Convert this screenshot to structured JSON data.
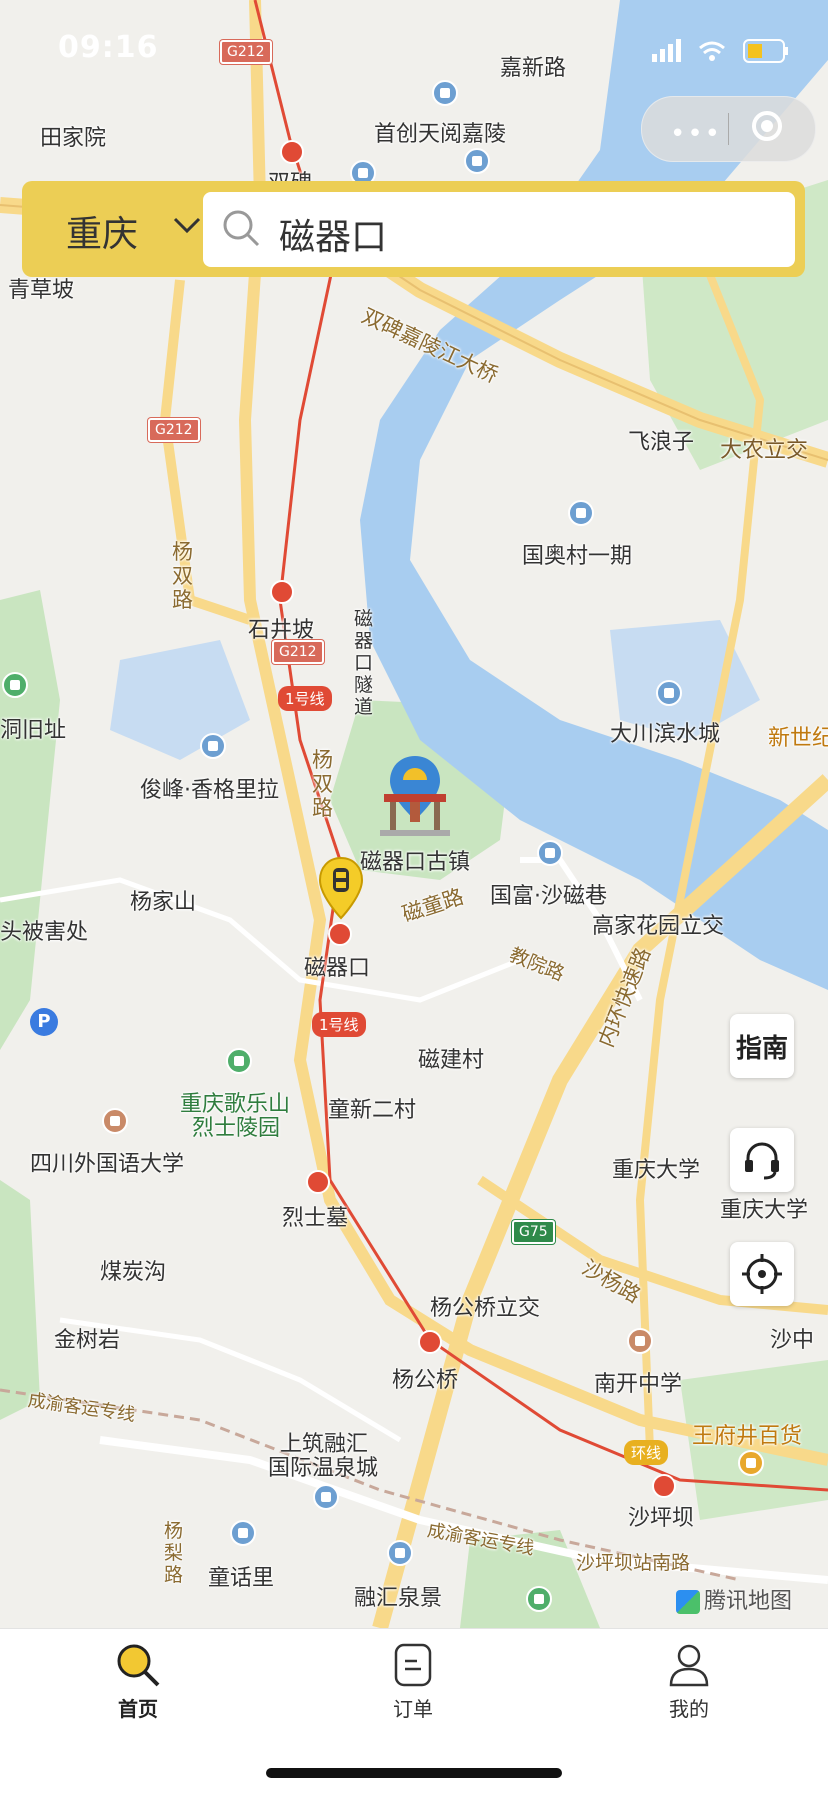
{
  "status_bar": {
    "time": "09:16"
  },
  "header": {
    "city": "重庆",
    "search_value": "磁器口"
  },
  "side_buttons": {
    "guide_label": "指南"
  },
  "map": {
    "labels": {
      "tianjiayuan": "田家院",
      "jialing_rd": "嘉新路",
      "shouchuang": "首创天阅嘉陵",
      "shuangbei": "双碑",
      "qingcaoba": "青草坡",
      "bridge": "双碑嘉陵江大桥",
      "feilangzi": "飞浪子",
      "danong": "大农立交",
      "aoyun": "国奥村一期",
      "yangshuang1": "杨双路",
      "shijingpo": "石井坡",
      "ciqikou_tunnel": "磁器口隧道",
      "dachuan": "大川滨水城",
      "xinshiji": "新世纪",
      "dongjiu": "洞旧址",
      "junfeng": "俊峰·香格里拉",
      "yangshuang2": "杨双路",
      "ancient_town": "磁器口古镇",
      "guofu": "国富·沙磁巷",
      "citong": "磁童路",
      "gaojia": "高家花园立交",
      "yangjiashan": "杨家山",
      "beihai": "头被害处",
      "ciqikou": "磁器口",
      "jiaoyuan": "教院路",
      "neihuan": "内环快速路",
      "cijian": "磁建村",
      "gelesan": "重庆歌乐山",
      "lieshilingyuan": "烈士陵园",
      "tongxin": "童新二村",
      "sisu": "四川外国语大学",
      "cqu1": "重庆大学",
      "cqu2": "重庆大学",
      "lieshimu": "烈士墓",
      "meitangou": "煤炭沟",
      "shayang": "沙杨路",
      "yanggongqiao_lj": "杨公桥立交",
      "jinshuyan": "金树岩",
      "yanggongqiao": "杨公桥",
      "nankai": "南开中学",
      "chengyu1": "成渝客运专线",
      "shangzhu1": "上筑融汇",
      "shangzhu2": "国际温泉城",
      "wangfujing": "王府井百货",
      "huanxian": "环线",
      "shapingba": "沙坪坝",
      "chengyu2": "成渝客运专线",
      "yangli": "杨梨路",
      "tonghuali": "童话里",
      "ronghui": "融汇泉景",
      "shapingba_s": "沙坪坝站南路",
      "shazhong": "沙中"
    },
    "badges": {
      "line1_a": "1号线",
      "line1_b": "1号线",
      "g212_a": "G212",
      "g212_b": "G212",
      "g212_c": "G212",
      "g75": "G75"
    },
    "watermark": "腾讯地图"
  },
  "tabs": [
    {
      "label": "首页",
      "icon": "search-tab-icon",
      "active": true
    },
    {
      "label": "订单",
      "icon": "order-icon",
      "active": false
    },
    {
      "label": "我的",
      "icon": "profile-icon",
      "active": false
    }
  ],
  "colors": {
    "accent": "#ecce55",
    "river": "#a8cdf0",
    "park": "#c9e5c0",
    "road": "#f8d98a",
    "metro": "#e04a35"
  }
}
